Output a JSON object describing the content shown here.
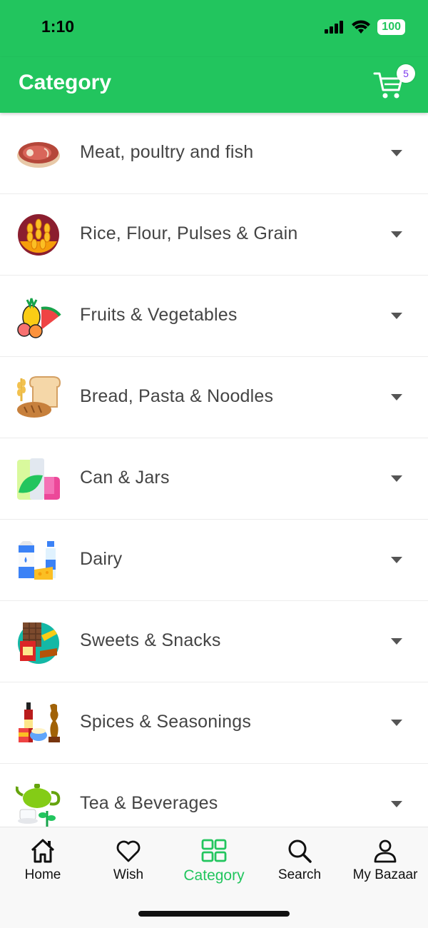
{
  "status": {
    "time": "1:10",
    "battery": "100"
  },
  "appbar": {
    "title": "Category",
    "cart_count": "5"
  },
  "categories": [
    {
      "label": "Meat, poultry and fish",
      "icon": "meat-icon"
    },
    {
      "label": "Rice, Flour, Pulses & Grain",
      "icon": "wheat-icon"
    },
    {
      "label": "Fruits & Vegetables",
      "icon": "fruits-icon"
    },
    {
      "label": "Bread, Pasta & Noodles",
      "icon": "bread-icon"
    },
    {
      "label": "Can & Jars",
      "icon": "jars-icon"
    },
    {
      "label": "Dairy",
      "icon": "dairy-icon"
    },
    {
      "label": "Sweets & Snacks",
      "icon": "snacks-icon"
    },
    {
      "label": "Spices & Seasonings",
      "icon": "spices-icon"
    },
    {
      "label": "Tea & Beverages",
      "icon": "tea-icon"
    }
  ],
  "nav": {
    "home": "Home",
    "wish": "Wish",
    "category": "Category",
    "search": "Search",
    "account": "My Bazaar"
  },
  "colors": {
    "brand": "#22c55e",
    "badge_text": "#7c3aed"
  }
}
